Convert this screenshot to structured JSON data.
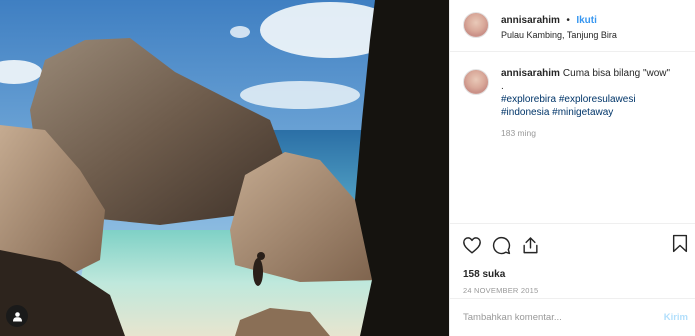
{
  "post": {
    "username": "annisarahim",
    "separator": "•",
    "follow_label": "Ikuti",
    "location": "Pulau Kambing, Tanjung Bira"
  },
  "caption": {
    "username": "annisarahim",
    "text": "Cuma bisa bilang \"wow\"",
    "dot_line": ".",
    "hashtags": [
      "#explorebira",
      "#exploresulawesi",
      "#indonesia",
      "#minigetaway"
    ],
    "time": "183 ming"
  },
  "actions": {
    "icons": [
      "heart-icon",
      "comment-icon",
      "share-icon",
      "bookmark-icon"
    ]
  },
  "likes": "158 suka",
  "date": "24 NOVEMBER 2015",
  "comment_box": {
    "placeholder": "Tambahkan komentar...",
    "send_label": "Kirim"
  },
  "colors": {
    "link_blue": "#3897f0",
    "hashtag": "#003569",
    "muted": "#999999",
    "send_disabled": "#b2dffc"
  }
}
